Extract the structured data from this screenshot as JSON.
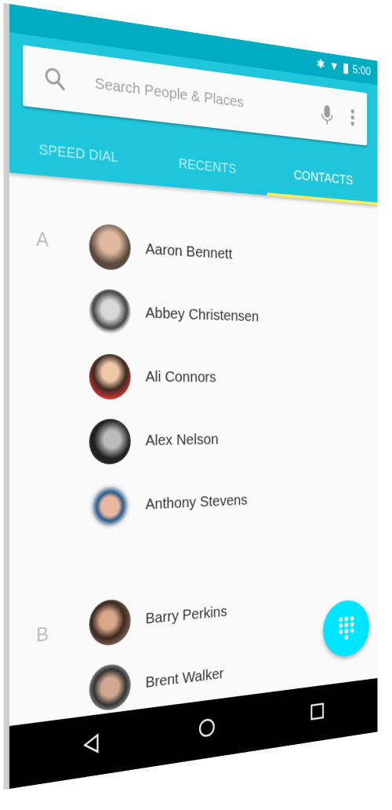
{
  "status_bar": {
    "time": "5:00",
    "icons": [
      "bluetooth-icon",
      "wifi-icon",
      "battery-icon"
    ]
  },
  "search": {
    "placeholder": "Search People  & Places",
    "icons": [
      "search-icon",
      "mic-icon",
      "more-vert-icon"
    ]
  },
  "tabs": [
    {
      "label": "SPEED DIAL",
      "active": false
    },
    {
      "label": "RECENTS",
      "active": false
    },
    {
      "label": "CONTACTS",
      "active": true
    }
  ],
  "sections": [
    {
      "letter": "A",
      "contacts": [
        "Aaron Bennett",
        "Abbey Christensen",
        "Ali Connors",
        "Alex Nelson",
        "Anthony Stevens"
      ]
    },
    {
      "letter": "B",
      "contacts": [
        "Barry Perkins",
        "Brent Walker"
      ]
    }
  ],
  "fab": {
    "icon": "dialpad-icon"
  },
  "nav": {
    "icons": [
      "back-icon",
      "home-icon",
      "recents-icon"
    ]
  },
  "colors": {
    "primary": "#1ec5db",
    "status": "#00acc1",
    "indicator": "#ffee58",
    "fab": "#00e5ff"
  }
}
